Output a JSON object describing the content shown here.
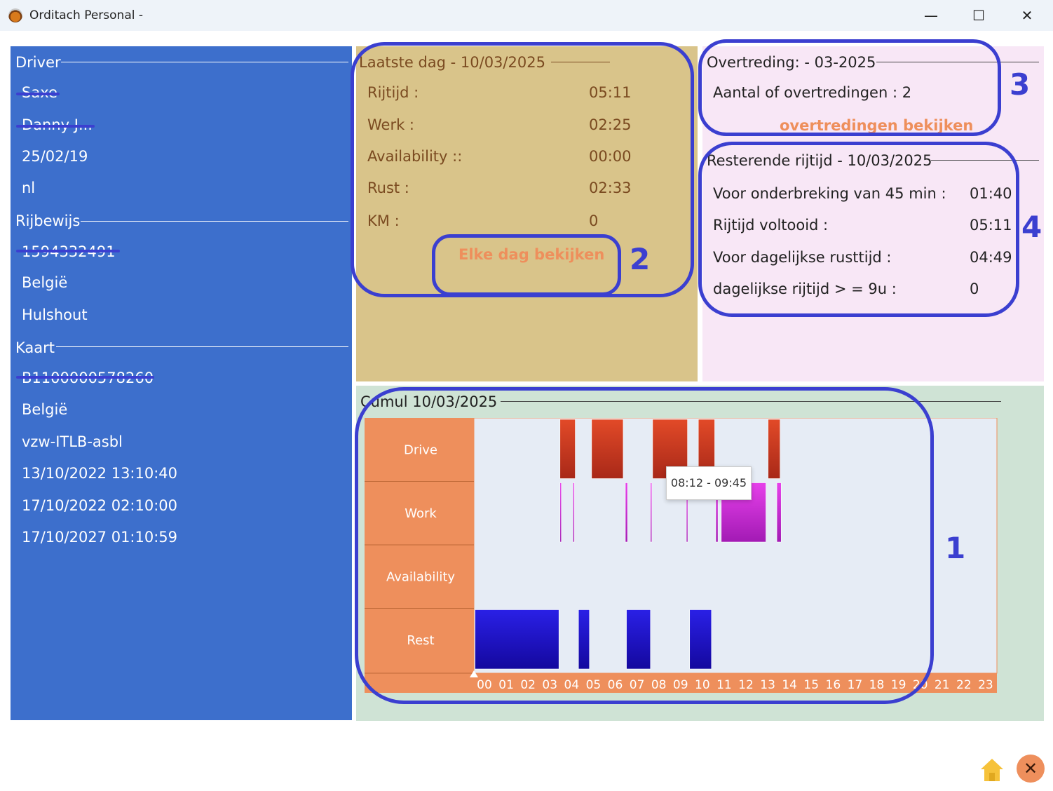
{
  "window": {
    "title": "Orditach Personal -",
    "minimize_glyph": "—",
    "maximize_glyph": "☐",
    "close_glyph": "✕"
  },
  "driver_panel": {
    "driver_label": "Driver",
    "driver_values": [
      "Saxe",
      "Danny J...",
      "25/02/19",
      "nl"
    ],
    "license_label": "Rijbewijs",
    "license_values": [
      "1594332491",
      "België",
      "Hulshout"
    ],
    "card_label": "Kaart",
    "card_values": [
      "B1100000578260",
      "België",
      "vzw-ITLB-asbl",
      "13/10/2022 13:10:40",
      "17/10/2022 02:10:00",
      "17/10/2027 01:10:59"
    ]
  },
  "last_day": {
    "title": "Laatste dag  - 10/03/2025",
    "rows": [
      {
        "label": "Rijtijd :",
        "value": "05:11"
      },
      {
        "label": "Werk :",
        "value": "02:25"
      },
      {
        "label": "Availability ::",
        "value": "00:00"
      },
      {
        "label": "Rust :",
        "value": "02:33"
      },
      {
        "label": "KM :",
        "value": "0"
      }
    ],
    "button_label": "Elke dag bekijken"
  },
  "violations": {
    "title": "Overtreding: - 03-2025",
    "count_text": "Aantal of overtredingen : 2",
    "button_label": "overtredingen  bekijken"
  },
  "remaining": {
    "title": "Resterende rijtijd - 10/03/2025",
    "rows": [
      {
        "label": "Voor onderbreking van 45 min :",
        "value": "01:40"
      },
      {
        "label": "Rijtijd voltooid :",
        "value": "05:11"
      },
      {
        "label": "Voor dagelijkse rusttijd :",
        "value": "04:49"
      },
      {
        "label": "dagelijkse rijtijd > = 9u :",
        "value": "0"
      }
    ]
  },
  "cumul": {
    "title": "Cumul 10/03/2025",
    "tooltip": "08:12 - 09:45"
  },
  "annotations": [
    "1",
    "2",
    "3",
    "4"
  ],
  "chart_data": {
    "type": "timeline",
    "title": "Cumul 10/03/2025",
    "x_unit": "hour",
    "xlim": [
      0,
      24
    ],
    "hours": [
      "00",
      "01",
      "02",
      "03",
      "04",
      "05",
      "06",
      "07",
      "08",
      "09",
      "10",
      "11",
      "12",
      "13",
      "14",
      "15",
      "16",
      "17",
      "18",
      "19",
      "20",
      "21",
      "22",
      "23"
    ],
    "rows": [
      {
        "name": "Drive",
        "segments": [
          [
            3.95,
            4.65
          ],
          [
            5.4,
            6.85
          ],
          [
            8.2,
            9.8
          ],
          [
            10.3,
            11.05
          ],
          [
            13.5,
            14.05
          ]
        ]
      },
      {
        "name": "Work",
        "segments": [
          [
            3.95,
            4.0
          ],
          [
            4.55,
            4.6
          ],
          [
            6.95,
            7.05
          ],
          [
            8.1,
            8.15
          ],
          [
            9.75,
            9.8
          ],
          [
            11.1,
            11.2
          ],
          [
            11.35,
            13.4
          ],
          [
            13.9,
            14.1
          ]
        ]
      },
      {
        "name": "Availability",
        "segments": []
      },
      {
        "name": "Rest",
        "segments": [
          [
            0.05,
            3.9
          ],
          [
            4.8,
            5.3
          ],
          [
            7.0,
            8.1
          ],
          [
            9.9,
            10.9
          ]
        ]
      }
    ],
    "tooltip": "08:12 - 09:45"
  },
  "colors": {
    "driver_panel": "#3d6fcc",
    "day_panel": "#d9c48a",
    "violation_panel": "#f8e7f6",
    "cumul_panel": "#cfe3d5",
    "accent": "#ee8f5c",
    "annotation": "#3b3fd0",
    "drive": "#c8341c",
    "work": "#c22ed0",
    "rest": "#1a10d8"
  },
  "icons": {
    "home": "home-icon",
    "close": "close-circle-icon",
    "app": "app-icon"
  },
  "footer": {
    "close_glyph": "✕"
  }
}
